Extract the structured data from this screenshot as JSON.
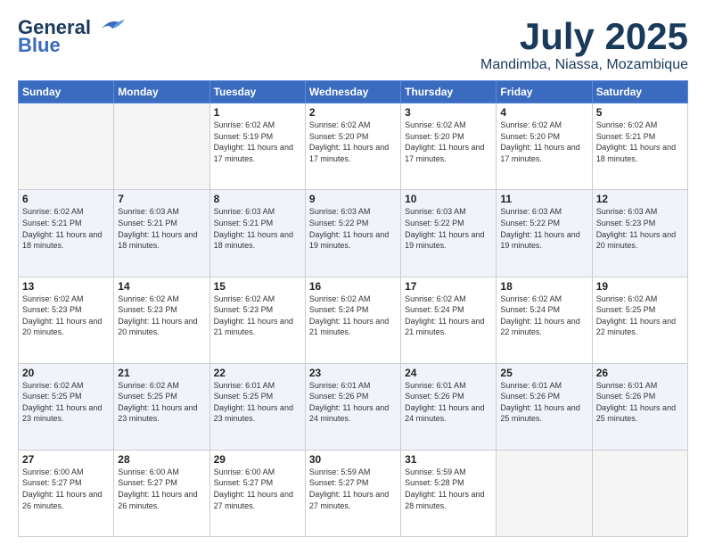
{
  "header": {
    "logo_general": "General",
    "logo_blue": "Blue",
    "month": "July 2025",
    "location": "Mandimba, Niassa, Mozambique"
  },
  "weekdays": [
    "Sunday",
    "Monday",
    "Tuesday",
    "Wednesday",
    "Thursday",
    "Friday",
    "Saturday"
  ],
  "weeks": [
    [
      {
        "day": "",
        "detail": ""
      },
      {
        "day": "",
        "detail": ""
      },
      {
        "day": "1",
        "detail": "Sunrise: 6:02 AM\nSunset: 5:19 PM\nDaylight: 11 hours and 17 minutes."
      },
      {
        "day": "2",
        "detail": "Sunrise: 6:02 AM\nSunset: 5:20 PM\nDaylight: 11 hours and 17 minutes."
      },
      {
        "day": "3",
        "detail": "Sunrise: 6:02 AM\nSunset: 5:20 PM\nDaylight: 11 hours and 17 minutes."
      },
      {
        "day": "4",
        "detail": "Sunrise: 6:02 AM\nSunset: 5:20 PM\nDaylight: 11 hours and 17 minutes."
      },
      {
        "day": "5",
        "detail": "Sunrise: 6:02 AM\nSunset: 5:21 PM\nDaylight: 11 hours and 18 minutes."
      }
    ],
    [
      {
        "day": "6",
        "detail": "Sunrise: 6:02 AM\nSunset: 5:21 PM\nDaylight: 11 hours and 18 minutes."
      },
      {
        "day": "7",
        "detail": "Sunrise: 6:03 AM\nSunset: 5:21 PM\nDaylight: 11 hours and 18 minutes."
      },
      {
        "day": "8",
        "detail": "Sunrise: 6:03 AM\nSunset: 5:21 PM\nDaylight: 11 hours and 18 minutes."
      },
      {
        "day": "9",
        "detail": "Sunrise: 6:03 AM\nSunset: 5:22 PM\nDaylight: 11 hours and 19 minutes."
      },
      {
        "day": "10",
        "detail": "Sunrise: 6:03 AM\nSunset: 5:22 PM\nDaylight: 11 hours and 19 minutes."
      },
      {
        "day": "11",
        "detail": "Sunrise: 6:03 AM\nSunset: 5:22 PM\nDaylight: 11 hours and 19 minutes."
      },
      {
        "day": "12",
        "detail": "Sunrise: 6:03 AM\nSunset: 5:23 PM\nDaylight: 11 hours and 20 minutes."
      }
    ],
    [
      {
        "day": "13",
        "detail": "Sunrise: 6:02 AM\nSunset: 5:23 PM\nDaylight: 11 hours and 20 minutes."
      },
      {
        "day": "14",
        "detail": "Sunrise: 6:02 AM\nSunset: 5:23 PM\nDaylight: 11 hours and 20 minutes."
      },
      {
        "day": "15",
        "detail": "Sunrise: 6:02 AM\nSunset: 5:23 PM\nDaylight: 11 hours and 21 minutes."
      },
      {
        "day": "16",
        "detail": "Sunrise: 6:02 AM\nSunset: 5:24 PM\nDaylight: 11 hours and 21 minutes."
      },
      {
        "day": "17",
        "detail": "Sunrise: 6:02 AM\nSunset: 5:24 PM\nDaylight: 11 hours and 21 minutes."
      },
      {
        "day": "18",
        "detail": "Sunrise: 6:02 AM\nSunset: 5:24 PM\nDaylight: 11 hours and 22 minutes."
      },
      {
        "day": "19",
        "detail": "Sunrise: 6:02 AM\nSunset: 5:25 PM\nDaylight: 11 hours and 22 minutes."
      }
    ],
    [
      {
        "day": "20",
        "detail": "Sunrise: 6:02 AM\nSunset: 5:25 PM\nDaylight: 11 hours and 23 minutes."
      },
      {
        "day": "21",
        "detail": "Sunrise: 6:02 AM\nSunset: 5:25 PM\nDaylight: 11 hours and 23 minutes."
      },
      {
        "day": "22",
        "detail": "Sunrise: 6:01 AM\nSunset: 5:25 PM\nDaylight: 11 hours and 23 minutes."
      },
      {
        "day": "23",
        "detail": "Sunrise: 6:01 AM\nSunset: 5:26 PM\nDaylight: 11 hours and 24 minutes."
      },
      {
        "day": "24",
        "detail": "Sunrise: 6:01 AM\nSunset: 5:26 PM\nDaylight: 11 hours and 24 minutes."
      },
      {
        "day": "25",
        "detail": "Sunrise: 6:01 AM\nSunset: 5:26 PM\nDaylight: 11 hours and 25 minutes."
      },
      {
        "day": "26",
        "detail": "Sunrise: 6:01 AM\nSunset: 5:26 PM\nDaylight: 11 hours and 25 minutes."
      }
    ],
    [
      {
        "day": "27",
        "detail": "Sunrise: 6:00 AM\nSunset: 5:27 PM\nDaylight: 11 hours and 26 minutes."
      },
      {
        "day": "28",
        "detail": "Sunrise: 6:00 AM\nSunset: 5:27 PM\nDaylight: 11 hours and 26 minutes."
      },
      {
        "day": "29",
        "detail": "Sunrise: 6:00 AM\nSunset: 5:27 PM\nDaylight: 11 hours and 27 minutes."
      },
      {
        "day": "30",
        "detail": "Sunrise: 5:59 AM\nSunset: 5:27 PM\nDaylight: 11 hours and 27 minutes."
      },
      {
        "day": "31",
        "detail": "Sunrise: 5:59 AM\nSunset: 5:28 PM\nDaylight: 11 hours and 28 minutes."
      },
      {
        "day": "",
        "detail": ""
      },
      {
        "day": "",
        "detail": ""
      }
    ]
  ]
}
